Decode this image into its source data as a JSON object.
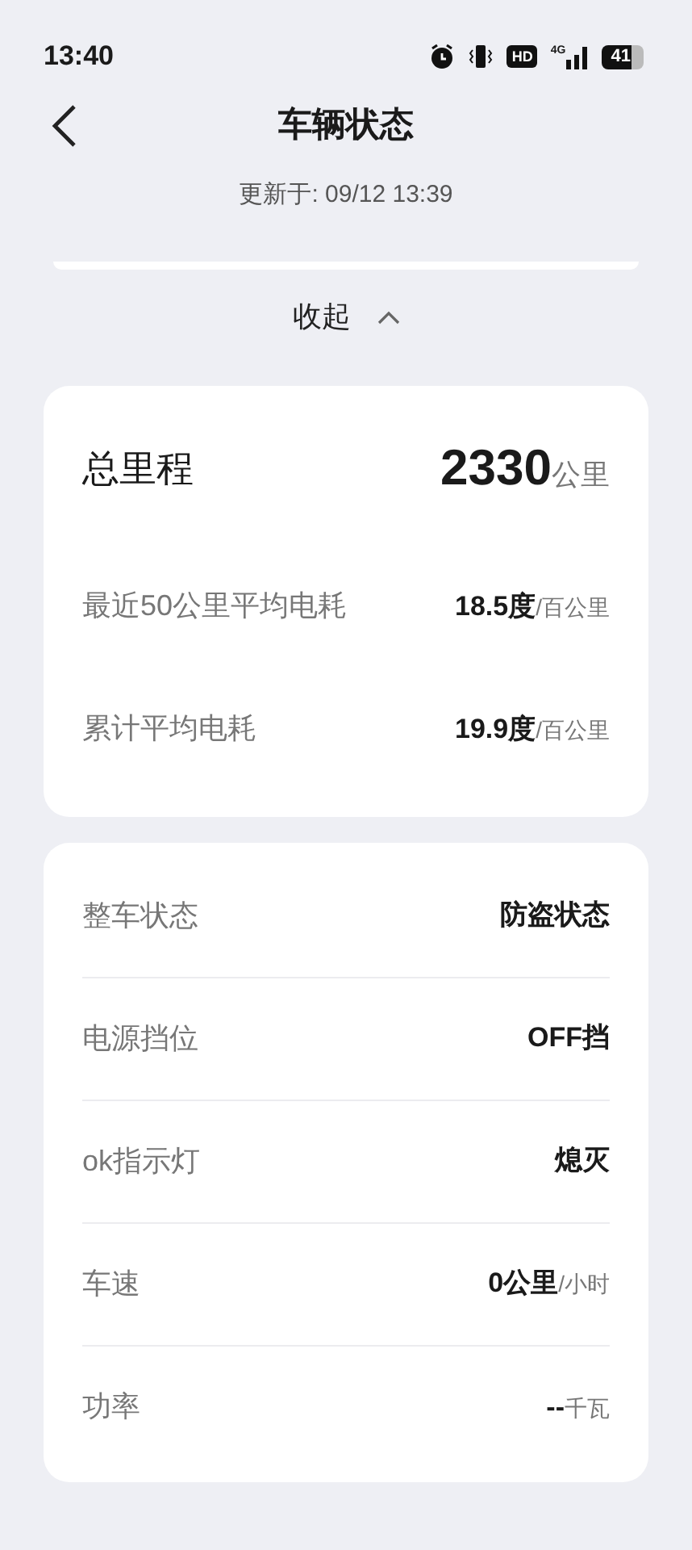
{
  "status_bar": {
    "time": "13:40",
    "hd": "HD",
    "network": "4G",
    "battery": "41"
  },
  "header": {
    "title": "车辆状态",
    "updated": "更新于: 09/12 13:39"
  },
  "collapse": {
    "label": "收起",
    "expanded": true
  },
  "mileage": {
    "label": "总里程",
    "value": "2330",
    "unit": "公里",
    "rows": [
      {
        "label": "最近50公里平均电耗",
        "value": "18.5度",
        "unit": "/百公里"
      },
      {
        "label": "累计平均电耗",
        "value": "19.9度",
        "unit": "/百公里"
      }
    ]
  },
  "status_rows": [
    {
      "label": "整车状态",
      "value": "防盗状态"
    },
    {
      "label": "电源挡位",
      "value": "OFF挡"
    },
    {
      "label": "ok指示灯",
      "value": "熄灭"
    },
    {
      "label": "车速",
      "value": "0公里",
      "unit": "/小时"
    },
    {
      "label": "功率",
      "value": "--",
      "unit": "千瓦"
    }
  ]
}
